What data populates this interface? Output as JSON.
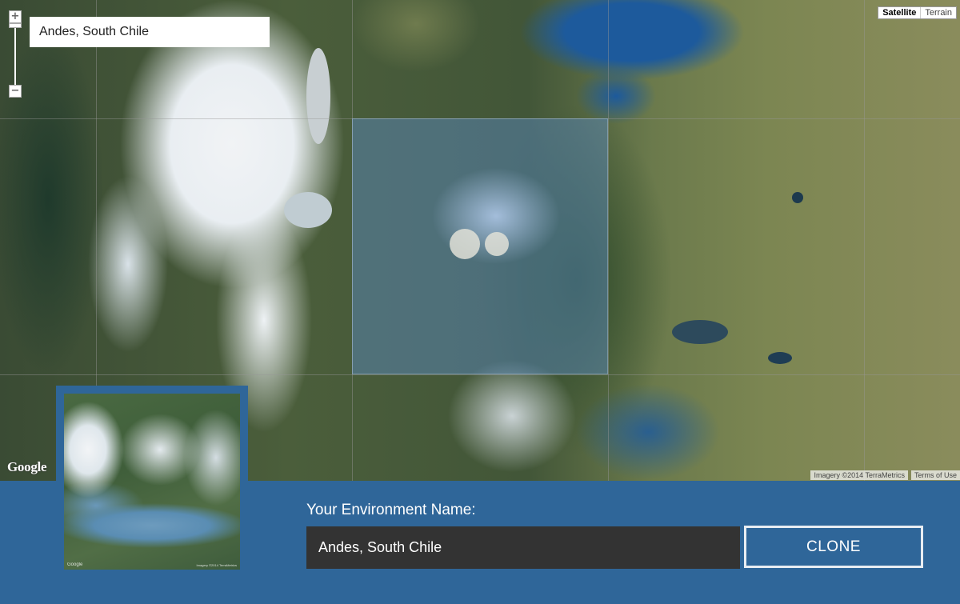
{
  "search": {
    "value": "Andes, South Chile"
  },
  "zoom": {
    "in_label": "+",
    "out_label": "−"
  },
  "map_type": {
    "options": [
      "Satellite",
      "Terrain"
    ],
    "selected": "Satellite"
  },
  "map_branding": {
    "logo_text": "Google",
    "imagery_credit": "Imagery ©2014 TerraMetrics",
    "terms_label": "Terms of Use"
  },
  "thumbnail": {
    "logo_text": "Google",
    "credit": "Imagery ©2014 TerraMetrics"
  },
  "form": {
    "name_label": "Your Environment Name:",
    "name_value": "Andes, South Chile",
    "clone_label": "CLONE"
  },
  "colors": {
    "panel_bg": "#2f6699",
    "input_bg": "#333333",
    "selection_tint": "#5a8cc8"
  }
}
